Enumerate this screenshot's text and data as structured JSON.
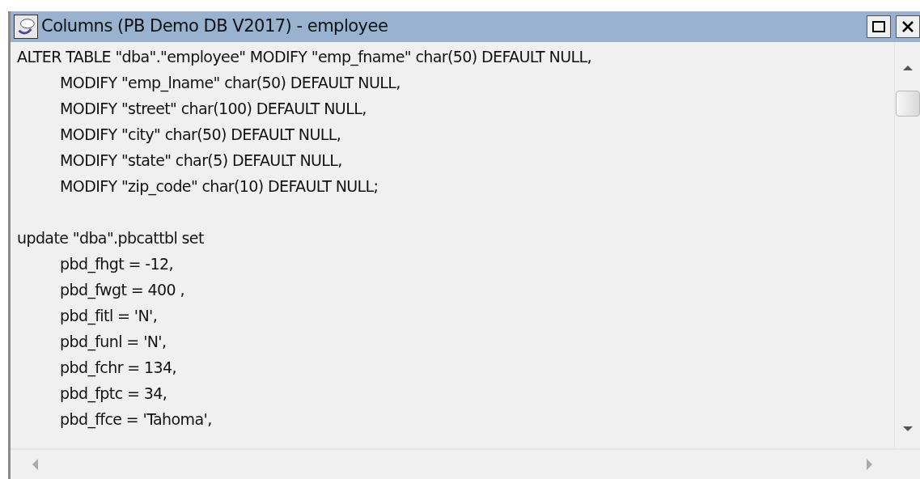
{
  "window": {
    "title": "Columns (PB Demo DB V2017) - employee"
  },
  "editor": {
    "statements": [
      {
        "text": "ALTER TABLE \"dba\".\"employee\" MODIFY \"emp_fname\" char(50) DEFAULT NULL,",
        "children": [
          {
            "text": "MODIFY \"emp_lname\" char(50) DEFAULT NULL,"
          },
          {
            "text": "MODIFY \"street\" char(100) DEFAULT NULL,"
          },
          {
            "text": "MODIFY \"city\" char(50) DEFAULT NULL,"
          },
          {
            "text": "MODIFY \"state\" char(5) DEFAULT NULL,"
          },
          {
            "text": "MODIFY \"zip_code\" char(10) DEFAULT NULL;"
          }
        ]
      },
      {
        "text": "update  \"dba\".pbcattbl set",
        "children": [
          {
            "text": "pbd_fhgt = -12,"
          },
          {
            "text": "pbd_fwgt = 400 ,"
          },
          {
            "text": "pbd_fitl = 'N',"
          },
          {
            "text": "pbd_funl = 'N',"
          },
          {
            "text": "pbd_fchr = 134,"
          },
          {
            "text": "pbd_fptc = 34,"
          },
          {
            "text": "pbd_ffce = 'Tahoma',"
          }
        ]
      }
    ]
  }
}
